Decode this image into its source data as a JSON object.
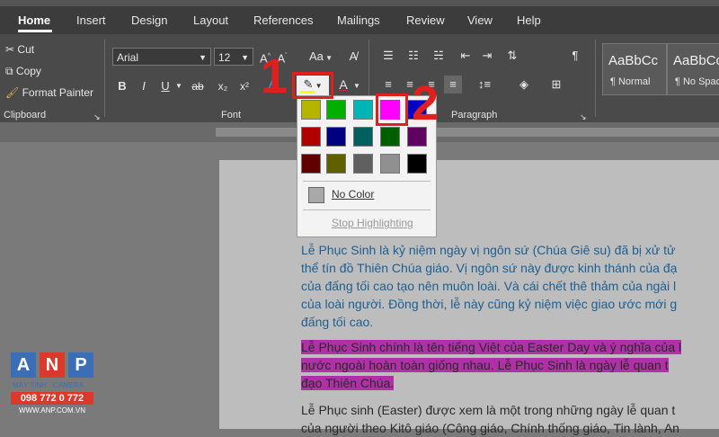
{
  "tabs": [
    "Home",
    "Insert",
    "Design",
    "Layout",
    "References",
    "Mailings",
    "Review",
    "View",
    "Help"
  ],
  "clipboard": {
    "cut": "Cut",
    "copy": "Copy",
    "format_painter": "Format Painter",
    "group_label": "Clipboard"
  },
  "font": {
    "font_name": "Arial",
    "font_size": "12",
    "change_case": "Aa",
    "group_label": "Font",
    "bold": "B",
    "italic": "I",
    "underline": "U",
    "strike": "ab",
    "subscript": "x₂",
    "superscript": "x²",
    "font_color": "A",
    "effects": "A"
  },
  "paragraph": {
    "group_label": "Paragraph",
    "show_marks": "¶"
  },
  "styles": [
    {
      "sample": "AaBbCc",
      "name": "¶ Normal"
    },
    {
      "sample": "AaBbCc",
      "name": "¶ No Spac"
    }
  ],
  "highlight_menu": {
    "no_color": "No Color",
    "stop": "Stop Highlighting",
    "selected_color": "#ff00ff",
    "swatches": [
      [
        "#b5b500",
        "#00b000",
        "#00b5b5",
        "#ff00ff",
        "#0000c8"
      ],
      [
        "#b00000",
        "#000080",
        "#006060",
        "#006000",
        "#600060"
      ],
      [
        "#600000",
        "#606000",
        "#606060",
        "#909090",
        "#000000"
      ]
    ]
  },
  "annotations": {
    "step1": "1",
    "step2": "2"
  },
  "document": {
    "para1": [
      "Lễ Phục Sinh là kỷ niệm ngày vị ngôn sứ (Chúa Giê su) đã bị xử tử",
      "thể tín đồ Thiên Chúa giáo. Vị ngôn sứ này được kinh thánh của đạ",
      "của đấng tối cao tạo nên muôn loài. Và cái chết thê thảm của ngài l",
      "của loài người. Đồng thời, lễ này cũng kỷ niệm việc giao ước mới g",
      "đấng tối cao."
    ],
    "para2": [
      "Lễ Phục Sinh chính là tên tiếng Việt của Easter Day và ý nghĩa của l",
      "nước ngoài hoàn toàn giống nhau. Lễ Phục Sinh là ngày lễ quan t",
      "đạo Thiên Chúa."
    ],
    "para3": [
      "Lễ Phục sinh (Easter) được xem là một trong những ngày lễ quan t",
      "của người theo Kitô giáo (Công giáo, Chính thống giáo, Tin lành, An"
    ]
  },
  "logo": {
    "letters": [
      "A",
      "N",
      "P"
    ],
    "tagline": "MÁY TÍNH · CAMERA",
    "phone": "098 772 0 772",
    "website": "WWW.ANP.COM.VN"
  }
}
